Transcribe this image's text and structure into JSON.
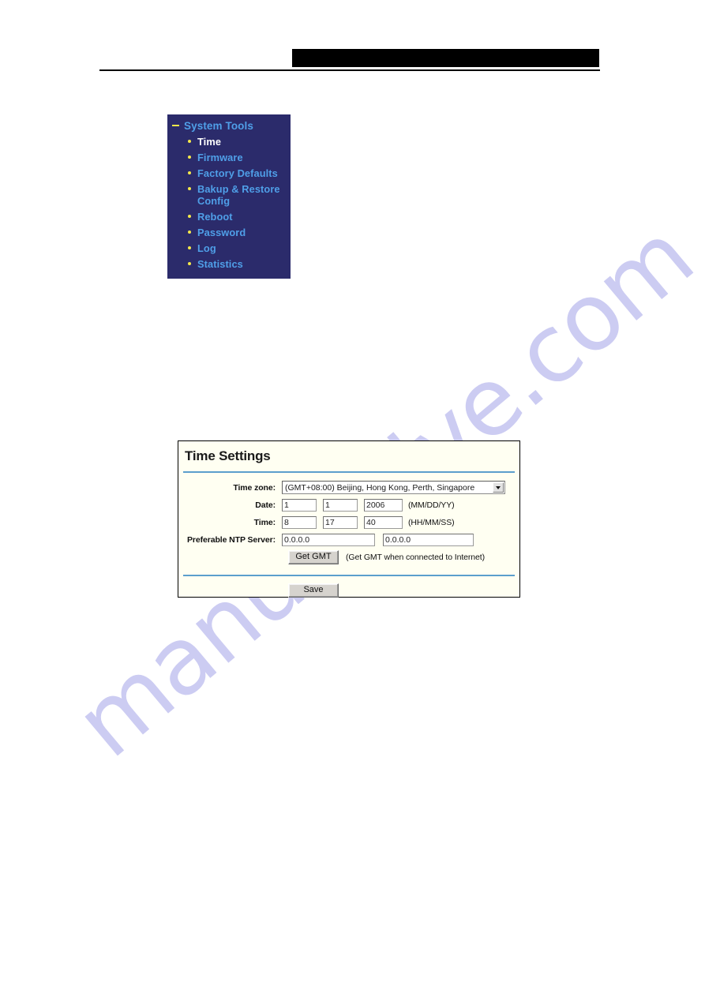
{
  "header": {
    "redaction_bar": "",
    "rule": ""
  },
  "watermark": {
    "text": "manualslive.com",
    "color": "#ccccf2"
  },
  "sidebar": {
    "title": "System Tools",
    "expand_icon": "minus-icon",
    "accent_color": "#4f9fe8",
    "background_color": "#2b2b6b",
    "bullet_color": "#f4e84a",
    "items": [
      {
        "label": "Time",
        "active": true
      },
      {
        "label": "Firmware",
        "active": false
      },
      {
        "label": "Factory Defaults",
        "active": false
      },
      {
        "label": "Bakup & Restore Config",
        "active": false
      },
      {
        "label": "Reboot",
        "active": false
      },
      {
        "label": "Password",
        "active": false
      },
      {
        "label": "Log",
        "active": false
      },
      {
        "label": "Statistics",
        "active": false
      }
    ]
  },
  "panel": {
    "title": "Time Settings",
    "divider_color": "#5c9fcd",
    "background_color": "#fffff2",
    "labels": {
      "timezone": "Time zone:",
      "date": "Date:",
      "time": "Time:",
      "ntp": "Preferable NTP Server:"
    },
    "timezone": {
      "selected": "(GMT+08:00) Beijing, Hong Kong, Perth, Singapore"
    },
    "date": {
      "month": "1",
      "day": "1",
      "year": "2006",
      "format_hint": "(MM/DD/YY)"
    },
    "time": {
      "hour": "8",
      "minute": "17",
      "second": "40",
      "format_hint": "(HH/MM/SS)"
    },
    "ntp": {
      "server1": "0.0.0.0",
      "server2": "0.0.0.0"
    },
    "get_gmt": {
      "button_label": "Get GMT",
      "hint": "(Get GMT when connected to Internet)"
    },
    "save": {
      "button_label": "Save"
    }
  }
}
